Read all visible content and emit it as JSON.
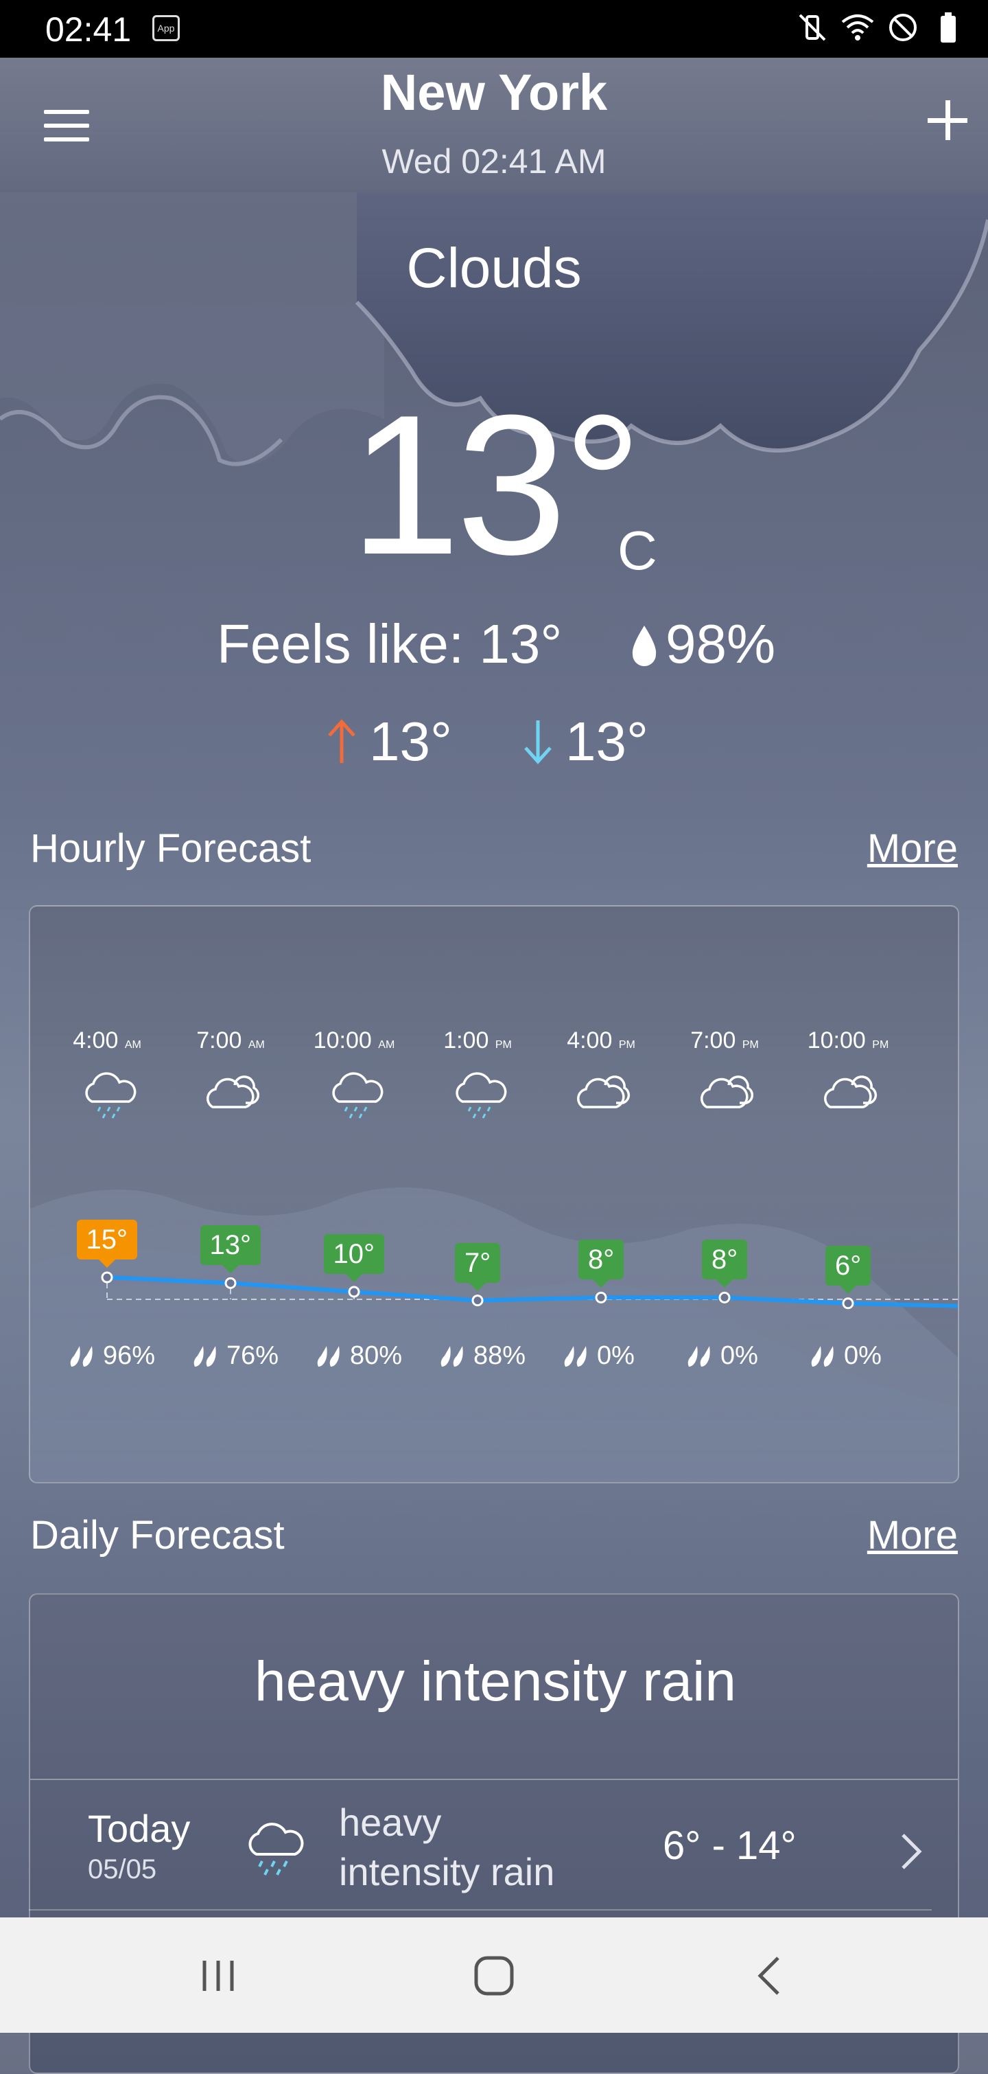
{
  "status_bar": {
    "time": "02:41",
    "app_badge": "App"
  },
  "header": {
    "city": "New York",
    "datetime": "Wed 02:41 AM"
  },
  "current": {
    "condition": "Clouds",
    "temperature": "13°",
    "unit": "C",
    "feels_like": "Feels like: 13°",
    "humidity": "98%",
    "high": "13°",
    "low": "13°"
  },
  "hourly": {
    "title": "Hourly Forecast",
    "more": "More",
    "items": [
      {
        "time": "4:00",
        "ampm": "AM",
        "icon": "cloud-rain-icon",
        "temp": "15°",
        "temp_value": 15,
        "highlight": true,
        "rain": "96%"
      },
      {
        "time": "7:00",
        "ampm": "AM",
        "icon": "cloudy-icon",
        "temp": "13°",
        "temp_value": 13,
        "rain": "76%"
      },
      {
        "time": "10:00",
        "ampm": "AM",
        "icon": "cloud-rain-icon",
        "temp": "10°",
        "temp_value": 10,
        "rain": "80%"
      },
      {
        "time": "1:00",
        "ampm": "PM",
        "icon": "cloud-rain-icon",
        "temp": "7°",
        "temp_value": 7,
        "rain": "88%"
      },
      {
        "time": "4:00",
        "ampm": "PM",
        "icon": "cloudy-icon",
        "temp": "8°",
        "temp_value": 8,
        "rain": "0%"
      },
      {
        "time": "7:00",
        "ampm": "PM",
        "icon": "cloudy-icon",
        "temp": "8°",
        "temp_value": 8,
        "rain": "0%"
      },
      {
        "time": "10:00",
        "ampm": "PM",
        "icon": "cloudy-icon",
        "temp": "6°",
        "temp_value": 6,
        "rain": "0%"
      }
    ]
  },
  "daily": {
    "title": "Daily Forecast",
    "more": "More",
    "summary": "heavy intensity rain",
    "rows": [
      {
        "day": "Today",
        "date": "05/05",
        "icon": "cloud-rain-icon",
        "desc": "heavy intensity rain",
        "range": "6° - 14°"
      }
    ]
  },
  "colors": {
    "line": "#2196f3",
    "tag_green": "#43a047",
    "tag_orange": "#f59300",
    "hi_arrow": "#f26b3a",
    "lo_arrow": "#6fd3f2"
  }
}
